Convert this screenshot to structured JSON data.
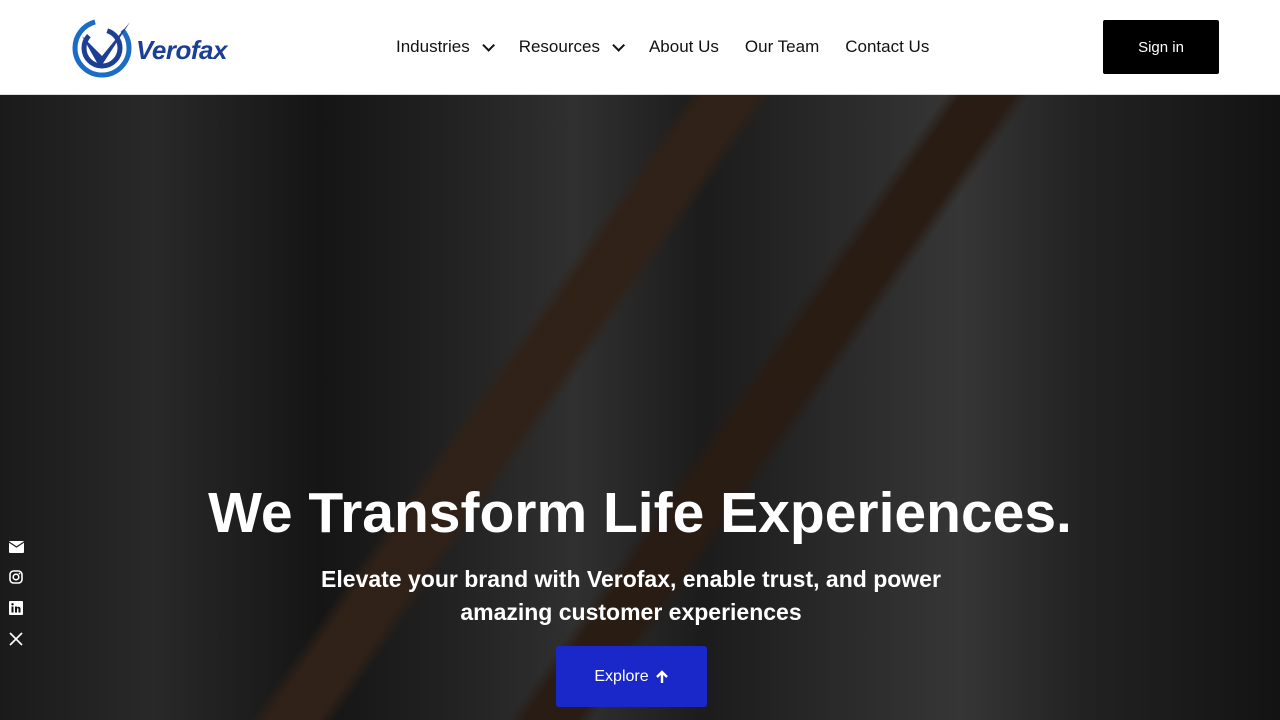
{
  "brand": {
    "name": "Verofax",
    "color": "#1c3f94"
  },
  "nav": {
    "items": [
      {
        "label": "Industries",
        "dropdown": true
      },
      {
        "label": "Resources",
        "dropdown": true
      },
      {
        "label": "About Us"
      },
      {
        "label": "Our Team"
      },
      {
        "label": "Contact Us"
      }
    ],
    "signin_label": "Sign in"
  },
  "hero": {
    "title": "We Transform Life Experiences.",
    "subtitle_line1": "Elevate your brand with Verofax, enable trust, and power",
    "subtitle_line2": "amazing customer experiences",
    "cta_label": "Explore",
    "cta_icon": "arrow-up-icon",
    "cta_color": "#1b28c9"
  },
  "social": [
    "envelope-icon",
    "instagram-icon",
    "linkedin-icon",
    "x-icon"
  ]
}
